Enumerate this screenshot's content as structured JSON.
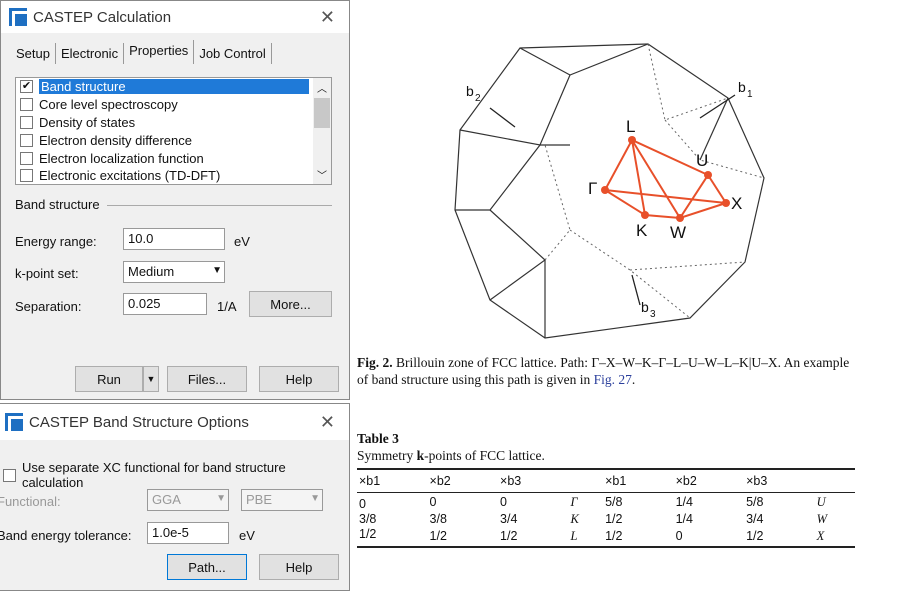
{
  "calc": {
    "title": "CASTEP Calculation",
    "tabs": [
      "Setup",
      "Electronic",
      "Properties",
      "Job Control"
    ],
    "properties": [
      {
        "label": "Band structure",
        "checked": true
      },
      {
        "label": "Core level spectroscopy",
        "checked": false
      },
      {
        "label": "Density of states",
        "checked": false
      },
      {
        "label": "Electron density difference",
        "checked": false
      },
      {
        "label": "Electron localization function",
        "checked": false
      },
      {
        "label": "Electronic excitations (TD-DFT)",
        "checked": false
      }
    ],
    "section": "Band structure",
    "energy_label": "Energy range:",
    "energy_value": "10.0",
    "energy_unit": "eV",
    "kpoint_label": "k-point set:",
    "kpoint_value": "Medium",
    "sep_label": "Separation:",
    "sep_value": "0.025",
    "sep_unit": "1/A",
    "more": "More...",
    "run": "Run",
    "files": "Files...",
    "help": "Help"
  },
  "bso": {
    "title": "CASTEP Band Structure Options",
    "xc_label": "Use separate XC functional for band structure calculation",
    "functional_label": "Functional:",
    "functional": "GGA",
    "functional2": "PBE",
    "tol_label": "Band energy tolerance:",
    "tol_value": "1.0e-5",
    "tol_unit": "eV",
    "path": "Path...",
    "help": "Help"
  },
  "figure": {
    "labels": {
      "b1": "b",
      "b1s": "1",
      "b2": "b",
      "b2s": "2",
      "b3": "b",
      "b3s": "3",
      "L": "L",
      "U": "U",
      "X": "X",
      "W": "W",
      "K": "K",
      "G": "Γ"
    },
    "cap_bold": "Fig. 2.",
    "cap_text": " Brillouin zone of FCC lattice. Path: Γ–X–W–K–Γ–L–U–W–L–K|U–X. An example of band structure using this path is given in ",
    "cap_link": "Fig. 27",
    "cap_end": ".",
    "path_color": "#e8502a"
  },
  "table": {
    "title": "Table 3",
    "caption_pre": "Symmetry ",
    "caption_bold": "k",
    "caption_post": "-points of FCC lattice.",
    "headers": [
      "×b1",
      "×b2",
      "×b3",
      "",
      "×b1",
      "×b2",
      "×b3",
      ""
    ],
    "rows": [
      [
        "0",
        "0",
        "0",
        "Γ",
        "5/8",
        "1/4",
        "5/8",
        "U"
      ],
      [
        "3/8",
        "3/8",
        "3/4",
        "K",
        "1/2",
        "1/4",
        "3/4",
        "W"
      ],
      [
        "1/2",
        "1/2",
        "1/2",
        "L",
        "1/2",
        "0",
        "1/2",
        "X"
      ]
    ]
  }
}
